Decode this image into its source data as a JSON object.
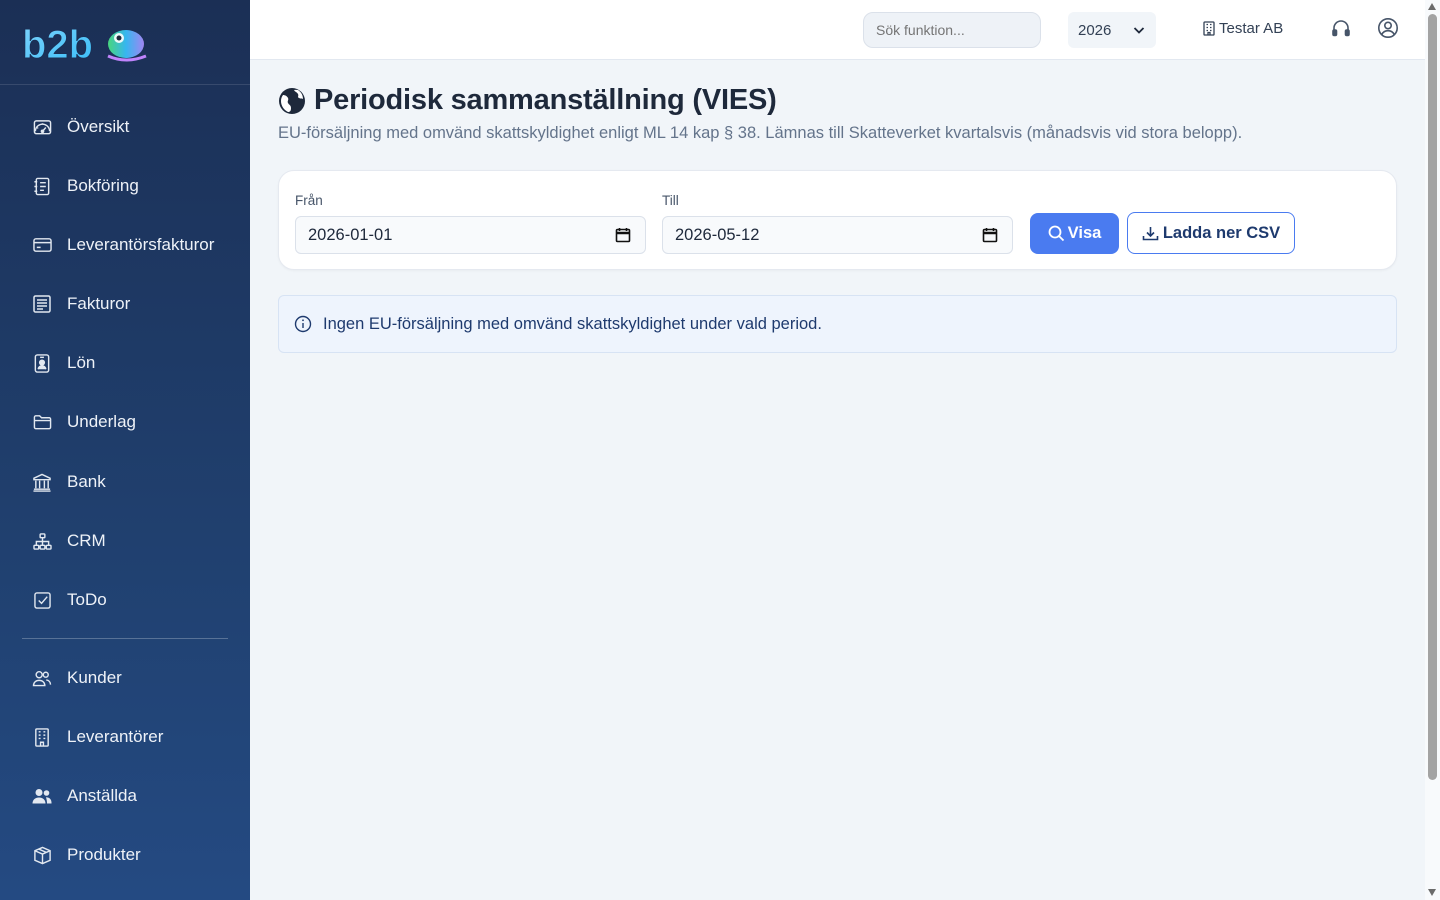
{
  "brand": {
    "logo_text": "b2b"
  },
  "sidebar": {
    "items": [
      {
        "label": "Översikt",
        "icon": "dashboard-gauge-icon"
      },
      {
        "label": "Bokföring",
        "icon": "journal-icon"
      },
      {
        "label": "Leverantörsfakturor",
        "icon": "credit-card-icon"
      },
      {
        "label": "Fakturor",
        "icon": "invoice-icon"
      },
      {
        "label": "Lön",
        "icon": "person-badge-icon"
      },
      {
        "label": "Underlag",
        "icon": "folder-icon"
      },
      {
        "label": "Bank",
        "icon": "bank-icon"
      },
      {
        "label": "CRM",
        "icon": "diagram-icon"
      },
      {
        "label": "ToDo",
        "icon": "check-square-icon"
      },
      {
        "label": "Kunder",
        "icon": "people-icon"
      },
      {
        "label": "Leverantörer",
        "icon": "building-icon"
      },
      {
        "label": "Anställda",
        "icon": "people-fill-icon"
      },
      {
        "label": "Produkter",
        "icon": "box-icon"
      }
    ]
  },
  "topbar": {
    "search_placeholder": "Sök funktion...",
    "year": "2026",
    "company": "Testar AB"
  },
  "page": {
    "title": "Periodisk sammanställning (VIES)",
    "subtitle": "EU-försäljning med omvänd skattskyldighet enligt ML 14 kap § 38. Lämnas till Skatteverket kvartalsvis (månadsvis vid stora belopp)."
  },
  "filters": {
    "from_label": "Från",
    "from_value": "2026-01-01",
    "to_label": "Till",
    "to_value": "2026-05-12",
    "show_button": "Visa",
    "csv_button": "Ladda ner CSV"
  },
  "info": {
    "message": "Ingen EU-försäljning med omvänd skattskyldighet under vald period."
  },
  "colors": {
    "sidebar_top": "#1b2f55",
    "sidebar_bottom": "#244a82",
    "primary": "#4a7bf0",
    "info_bg": "#eef4fd",
    "background": "#f1f5f9"
  }
}
